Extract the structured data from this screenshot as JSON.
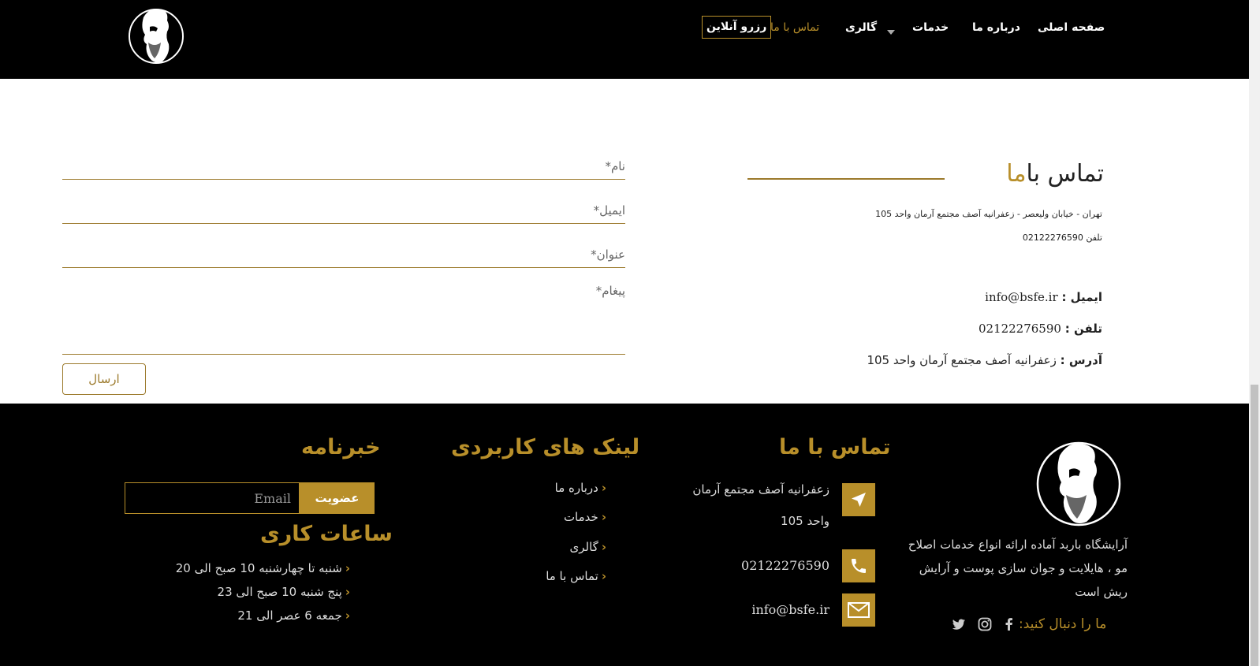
{
  "header": {
    "nav": {
      "home": "صفحه اصلی",
      "about": "درباره ما",
      "services": "خدمات",
      "gallery": "گالری",
      "contact": "تماس با ما",
      "reserve": "رزرو آنلاین"
    },
    "logo_icon": "bearded-man-logo-icon"
  },
  "contact": {
    "title_prefix": "تماس با",
    "title_accent": "ما",
    "address_line": "تهران - خیابان ولیعصر - زعفرانیه آصف مجتمع آرمان واحد 105",
    "phone_line": "تلفن 02122276590",
    "email_label": "ایمیل :",
    "email_value": "info@bsfe.ir",
    "phone_label": "تلفن :",
    "phone_value": "02122276590",
    "address_label": "آدرس :",
    "address_value": "زعفرانیه آصف مجتمع آرمان واحد 105"
  },
  "form": {
    "name_placeholder": "نام*",
    "email_placeholder": "ایمیل*",
    "subject_placeholder": "عنوان*",
    "message_placeholder": "پیغام*",
    "submit_label": "ارسال"
  },
  "footer": {
    "about_text": "آرایشگاه باربد آماده ارائه انواع خدمات اصلاح مو ، هایلایت و جوان سازی پوست و آرایش ریش است",
    "follow_label": "ما را دنبال کنید:",
    "contact_heading": "تماس با ما",
    "contact_address": "زعفرانیه آصف مجتمع آرمان",
    "contact_address_2": "واحد 105",
    "contact_phone": "02122276590",
    "contact_email": "info@bsfe.ir",
    "links_heading": "لینک های کاربردی",
    "links": [
      "درباره ما",
      "خدمات",
      "گالری",
      "تماس با ما"
    ],
    "newsletter_heading": "خبرنامه",
    "newsletter_placeholder": "Email",
    "newsletter_button": "عضویت",
    "hours_heading": "ساعات کاری",
    "hours": [
      "شنبه تا چهارشنبه 10 صبح الی 20",
      "پنج شنبه 10 صبح الی 23",
      "جمعه 6 عصر الی 21"
    ]
  },
  "colors": {
    "accent": "#b88f2a",
    "header_bg": "#000000",
    "footer_bg": "#000000"
  }
}
